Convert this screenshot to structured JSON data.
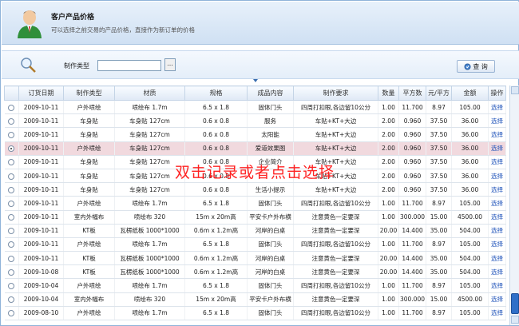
{
  "header": {
    "title": "客户产品价格",
    "subtitle": "可以选择之前交易的产品价格，直接作为新订单的价格"
  },
  "filter": {
    "label": "制作类型",
    "value": "",
    "browse": "...",
    "query": "查 询"
  },
  "columns": [
    "",
    "订货日期",
    "制作类型",
    "材质",
    "规格",
    "成品内容",
    "制作要求",
    "数量",
    "平方数",
    "元/平方",
    "金额",
    "操作"
  ],
  "rows": [
    [
      "",
      "2009-10-11",
      "户外喷绘",
      "喷绘布 1.7m",
      "6.5 x 1.8",
      "固体门头",
      "四周打扣眼,各边留10公分",
      "1.00",
      "11.700",
      "8.97",
      "105.00",
      "选择"
    ],
    [
      "",
      "2009-10-11",
      "车身贴",
      "车身贴 127cm",
      "0.6 x 0.8",
      "服务",
      "车贴+KT+大边",
      "2.00",
      "0.960",
      "37.50",
      "36.00",
      "选择"
    ],
    [
      "",
      "2009-10-11",
      "车身贴",
      "车身贴 127cm",
      "0.6 x 0.8",
      "太阳能",
      "车贴+KT+大边",
      "2.00",
      "0.960",
      "37.50",
      "36.00",
      "选择"
    ],
    [
      "",
      "2009-10-11",
      "户外喷绘",
      "车身贴 127cm",
      "0.6 x 0.8",
      "爱道效果图",
      "车贴+KT+大边",
      "2.00",
      "0.960",
      "37.50",
      "36.00",
      "选择"
    ],
    [
      "",
      "2009-10-11",
      "车身贴",
      "车身贴 127cm",
      "0.6 x 0.8",
      "企业简介",
      "车贴+KT+大边",
      "2.00",
      "0.960",
      "37.50",
      "36.00",
      "选择"
    ],
    [
      "",
      "2009-10-11",
      "车身贴",
      "车身贴 127cm",
      "0.6 x 0.8",
      "",
      "车贴+KT+大边",
      "2.00",
      "0.960",
      "37.50",
      "36.00",
      "选择"
    ],
    [
      "",
      "2009-10-11",
      "车身贴",
      "车身贴 127cm",
      "0.6 x 0.8",
      "生活小提示",
      "车贴+KT+大边",
      "2.00",
      "0.960",
      "37.50",
      "36.00",
      "选择"
    ],
    [
      "",
      "2009-10-11",
      "户外喷绘",
      "喷绘布 1.7m",
      "6.5 x 1.8",
      "固体门头",
      "四周打扣眼,各边留10公分",
      "1.00",
      "11.700",
      "8.97",
      "105.00",
      "选择"
    ],
    [
      "",
      "2009-10-11",
      "室内外幅布",
      "喷绘布 320",
      "15m x 20m高",
      "平安卡户外布横",
      "注意黄色一定要深",
      "1.00",
      "300.000",
      "15.00",
      "4500.00",
      "选择"
    ],
    [
      "",
      "2009-10-11",
      "KT板",
      "瓦楞纸板 1000*1000",
      "0.6m x 1.2m高",
      "河岸的白桌",
      "注意黄色一定要深",
      "20.00",
      "14.400",
      "35.00",
      "504.00",
      "选择"
    ],
    [
      "",
      "2009-10-11",
      "户外喷绘",
      "喷绘布 1.7m",
      "6.5 x 1.8",
      "固体门头",
      "四周打扣眼,各边留10公分",
      "1.00",
      "11.700",
      "8.97",
      "105.00",
      "选择"
    ],
    [
      "",
      "2009-10-11",
      "KT板",
      "瓦楞纸板 1000*1000",
      "0.6m x 1.2m高",
      "河岸的白桌",
      "注意黄色一定要深",
      "20.00",
      "14.400",
      "35.00",
      "504.00",
      "选择"
    ],
    [
      "",
      "2009-10-08",
      "KT板",
      "瓦楞纸板 1000*1000",
      "0.6m x 1.2m高",
      "河岸的白桌",
      "注意黄色一定要深",
      "20.00",
      "14.400",
      "35.00",
      "504.00",
      "选择"
    ],
    [
      "",
      "2009-10-04",
      "户外喷绘",
      "喷绘布 1.7m",
      "6.5 x 1.8",
      "固体门头",
      "四周打扣眼,各边留10公分",
      "1.00",
      "11.700",
      "8.97",
      "105.00",
      "选择"
    ],
    [
      "",
      "2009-10-04",
      "室内外幅布",
      "喷绘布 320",
      "15m x 20m高",
      "平安卡户外布横",
      "注意黄色一定要深",
      "1.00",
      "300.000",
      "15.00",
      "4500.00",
      "选择"
    ],
    [
      "",
      "2009-08-10",
      "户外喷绘",
      "喷绘布 1.7m",
      "6.5 x 1.8",
      "固体门头",
      "四周打扣眼,各边留10公分",
      "1.00",
      "11.700",
      "8.97",
      "105.00",
      "选择"
    ]
  ],
  "selected_row": 3,
  "overlay_text": "双击记录或者点击选择",
  "icons": [
    "user-avatar-icon",
    "magnifier-icon",
    "search-icon",
    "collapse-arrow-icon"
  ]
}
